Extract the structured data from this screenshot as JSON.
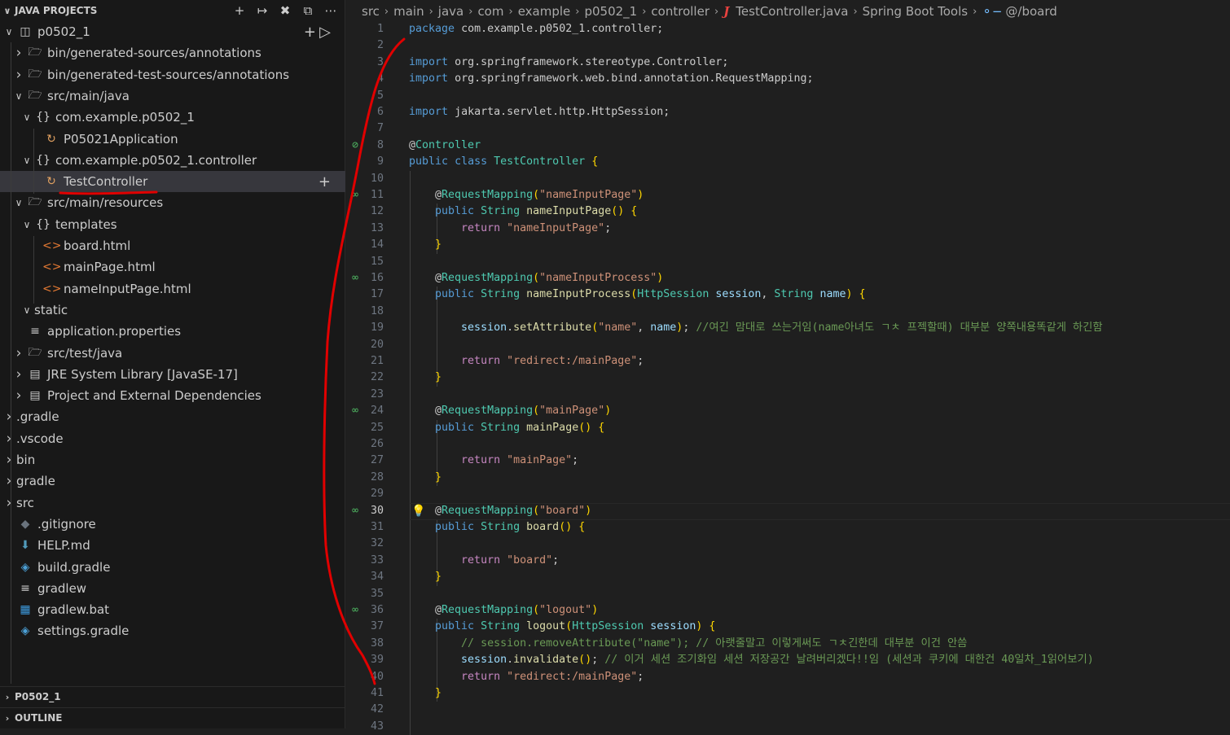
{
  "sidebar": {
    "title": "JAVA PROJECTS",
    "toolbar_icons": [
      "add-icon",
      "link-icon",
      "tools-icon",
      "collapse-icon",
      "more-icon"
    ],
    "tree": [
      {
        "label": "p0502_1",
        "icon": "project-icon"
      },
      {
        "label": "bin/generated-sources/annotations",
        "icon": "folder-package-icon"
      },
      {
        "label": "bin/generated-test-sources/annotations",
        "icon": "folder-package-icon"
      },
      {
        "label": "src/main/java",
        "icon": "folder-package-icon"
      },
      {
        "label": "com.example.p0502_1",
        "icon": "package-icon"
      },
      {
        "label": "P05021Application",
        "icon": "spring-class-icon"
      },
      {
        "label": "com.example.p0502_1.controller",
        "icon": "package-icon"
      },
      {
        "label": "TestController",
        "icon": "spring-class-icon"
      },
      {
        "label": "src/main/resources",
        "icon": "folder-package-icon"
      },
      {
        "label": "templates",
        "icon": "package-icon"
      },
      {
        "label": "board.html",
        "icon": "html-icon"
      },
      {
        "label": "mainPage.html",
        "icon": "html-icon"
      },
      {
        "label": "nameInputPage.html",
        "icon": "html-icon"
      },
      {
        "label": "static",
        "icon": "none"
      },
      {
        "label": "application.properties",
        "icon": "properties-icon"
      },
      {
        "label": "src/test/java",
        "icon": "folder-package-icon"
      },
      {
        "label": "JRE System Library [JavaSE-17]",
        "icon": "library-icon"
      },
      {
        "label": "Project and External Dependencies",
        "icon": "library-icon"
      },
      {
        "label": ".gradle",
        "icon": "none"
      },
      {
        "label": ".vscode",
        "icon": "none"
      },
      {
        "label": "bin",
        "icon": "none"
      },
      {
        "label": "gradle",
        "icon": "none"
      },
      {
        "label": "src",
        "icon": "none"
      },
      {
        "label": ".gitignore",
        "icon": "git-icon"
      },
      {
        "label": "HELP.md",
        "icon": "download-icon"
      },
      {
        "label": "build.gradle",
        "icon": "gradle-icon"
      },
      {
        "label": "gradlew",
        "icon": "lines-icon"
      },
      {
        "label": "gradlew.bat",
        "icon": "windows-icon"
      },
      {
        "label": "settings.gradle",
        "icon": "gradle-icon"
      }
    ],
    "bottom_sections": [
      "P0502_1",
      "OUTLINE"
    ]
  },
  "breadcrumb": [
    "src",
    "main",
    "java",
    "com",
    "example",
    "p0502_1",
    "controller",
    "TestController.java",
    "Spring Boot Tools",
    "@/board"
  ],
  "editor": {
    "active_line": 30,
    "line_count": 43,
    "code": [
      "package com.example.p0502_1.controller;",
      "",
      "import org.springframework.stereotype.Controller;",
      "import org.springframework.web.bind.annotation.RequestMapping;",
      "",
      "import jakarta.servlet.http.HttpSession;",
      "",
      "@Controller",
      "public class TestController {",
      "",
      "    @RequestMapping(\"nameInputPage\")",
      "    public String nameInputPage() {",
      "        return \"nameInputPage\";",
      "    }",
      "",
      "    @RequestMapping(\"nameInputProcess\")",
      "    public String nameInputProcess(HttpSession session, String name) {",
      "",
      "        session.setAttribute(\"name\", name); //여긴 맘대로 쓰는거임(name아녀도 ㄱㅊ 프젝할때) 대부분 양쪽내용똑같게 하긴함",
      "",
      "        return \"redirect:/mainPage\";",
      "    }",
      "",
      "    @RequestMapping(\"mainPage\")",
      "    public String mainPage() {",
      "",
      "        return \"mainPage\";",
      "    }",
      "",
      "    @RequestMapping(\"board\")",
      "    public String board() {",
      "",
      "        return \"board\";",
      "    }",
      "",
      "    @RequestMapping(\"logout\")",
      "    public String logout(HttpSession session) {",
      "        // session.removeAttribute(\"name\"); // 아랫줄말고 이렇게써도 ㄱㅊ긴한데 대부분 이건 안씀",
      "        session.invalidate(); // 이거 세션 조기화임 세션 저장공간 날려버리겠다!!임 (세션과 쿠키에 대한건 40일차_1읽어보기)",
      "        return \"redirect:/mainPage\";",
      "    }",
      "",
      ""
    ],
    "gutter_markers": [
      8,
      11,
      16,
      24,
      30,
      36
    ],
    "lightbulb_line": 30
  },
  "colors": {
    "background": "#1f1f1f",
    "sidebar_bg": "#181818",
    "keyword": "#569cd6",
    "type": "#4ec9b0",
    "function": "#dcdcaa",
    "variable": "#9cdcfe",
    "string": "#ce9178",
    "comment": "#6a9955",
    "annotation_red": "#e00000"
  }
}
